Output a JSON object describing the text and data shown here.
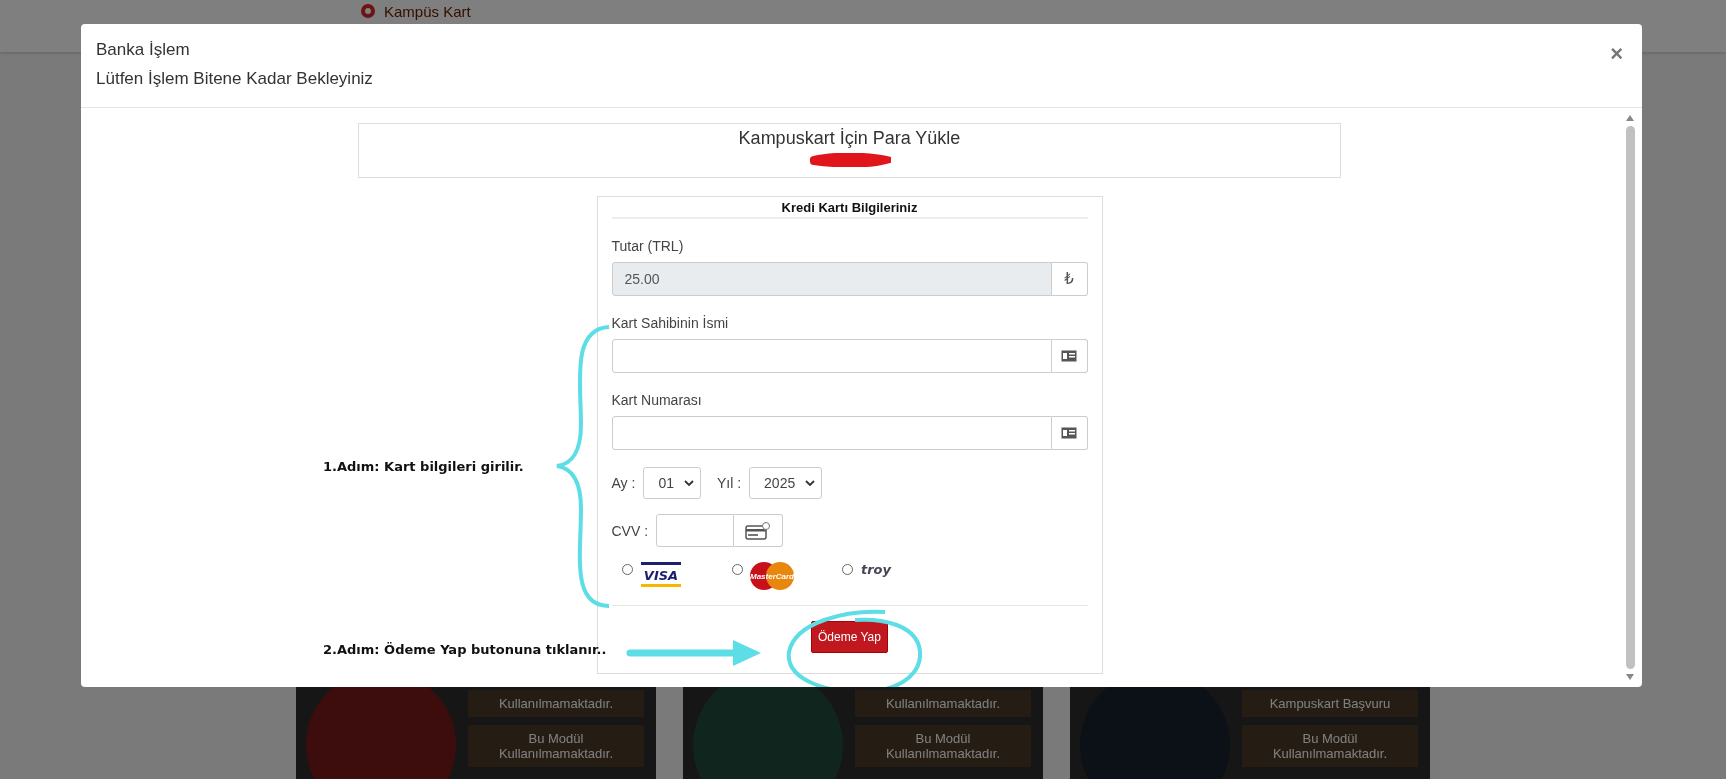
{
  "background_page": {
    "brand": "Kampüs Kart",
    "module_cards": [
      {
        "buttons": [
          "Kullanılmamaktadır.",
          "Bu Modül Kullanılmamaktadır."
        ]
      },
      {
        "buttons": [
          "Kullanılmamaktadır.",
          "Bu Modül Kullanılmamaktadır."
        ]
      },
      {
        "buttons": [
          "Kampuskart Başvuru",
          "Bu Modül Kullanılmamaktadır."
        ]
      }
    ]
  },
  "modal": {
    "title": "Banka İşlem",
    "subtitle": "Lütfen İşlem Bitene Kadar Bekleyiniz",
    "close": "×",
    "heading": "Kampuskart İçin Para Yükle",
    "form": {
      "title": "Kredi Kartı Bilgileriniz",
      "fields": [
        {
          "label": "Tutar (TRL)",
          "value": "25.00",
          "disabled": true,
          "addon": "₺"
        },
        {
          "label": "Kart Sahibinin İsmi",
          "disabled": false
        },
        {
          "label": "Kart Numarası",
          "disabled": false
        }
      ],
      "month": {
        "label": "Ay :",
        "value": "01"
      },
      "year": {
        "label": "Yıl :",
        "value": "2025"
      },
      "cvv": {
        "label": "CVV :"
      },
      "card_types": [
        {
          "kind": "visa",
          "logo": "VISA",
          "selected": false
        },
        {
          "kind": "mastercard",
          "logo": "MasterCard",
          "selected": false
        },
        {
          "kind": "troy",
          "logo": "troy",
          "selected": false
        }
      ],
      "submit": "Ödeme Yap"
    },
    "annotations": [
      {
        "kind": "brace",
        "text": "1.Adım: Kart bilgileri girilir."
      },
      {
        "kind": "arrow",
        "text": "2.Adım: Ödeme Yap butonuna tıklanır.."
      }
    ]
  }
}
